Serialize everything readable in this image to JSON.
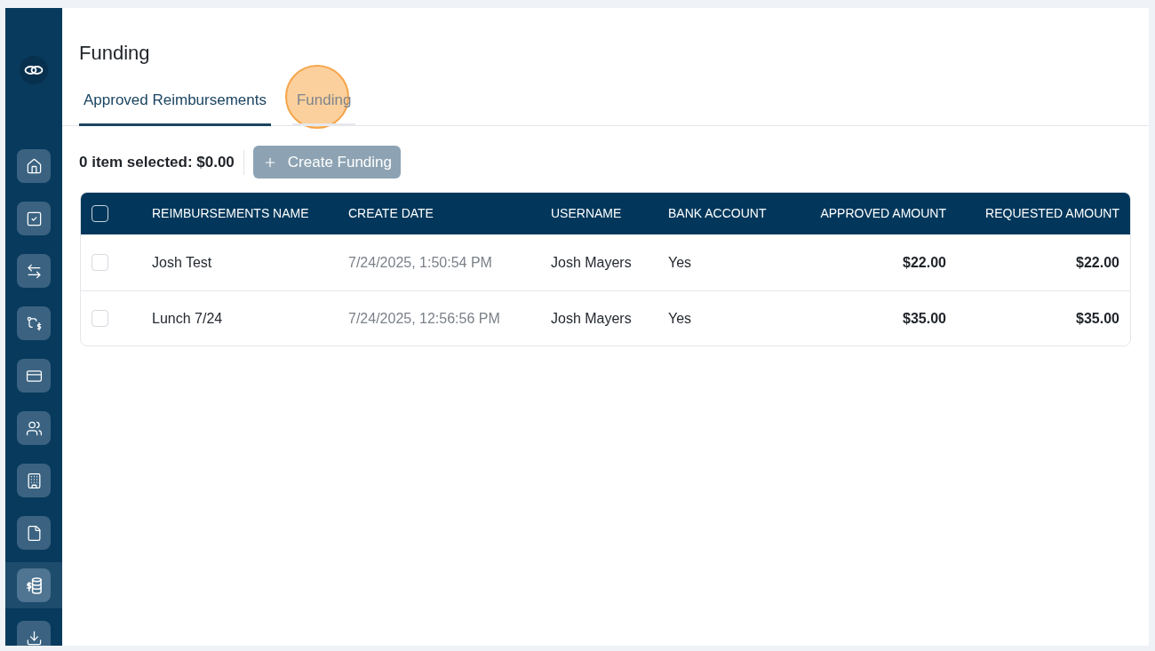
{
  "sidebar": {
    "items": [
      {
        "selected": false
      },
      {
        "selected": false
      },
      {
        "selected": false
      },
      {
        "selected": false
      },
      {
        "selected": false
      },
      {
        "selected": false
      },
      {
        "selected": false
      },
      {
        "selected": false
      },
      {
        "selected": true
      },
      {
        "selected": false
      }
    ]
  },
  "page": {
    "title": "Funding"
  },
  "tabs": [
    {
      "label": "Approved Reimbursements",
      "selected": true
    },
    {
      "label": "Funding",
      "selected": false
    }
  ],
  "toolbar": {
    "selection_summary": "0 item selected: $0.00",
    "create_button": {
      "label": "Create Funding",
      "disabled": true
    }
  },
  "table": {
    "header_checkbox": {
      "checked": false
    },
    "columns": [
      {
        "label": "REIMBURSEMENTS NAME",
        "kind": "text"
      },
      {
        "label": "CREATE DATE",
        "kind": "date"
      },
      {
        "label": "USERNAME",
        "kind": "text"
      },
      {
        "label": "BANK ACCOUNT",
        "kind": "text"
      },
      {
        "label": "APPROVED AMOUNT",
        "kind": "amount"
      },
      {
        "label": "REQUESTED AMOUNT",
        "kind": "amount"
      }
    ],
    "rows": [
      {
        "checked": false,
        "cells": [
          "Josh Test",
          "7/24/2025, 1:50:54 PM",
          "Josh Mayers",
          "Yes",
          "$22.00",
          "$22.00"
        ]
      },
      {
        "checked": false,
        "cells": [
          "Lunch 7/24",
          "7/24/2025, 12:56:56 PM",
          "Josh Mayers",
          "Yes",
          "$35.00",
          "$35.00"
        ]
      }
    ]
  }
}
